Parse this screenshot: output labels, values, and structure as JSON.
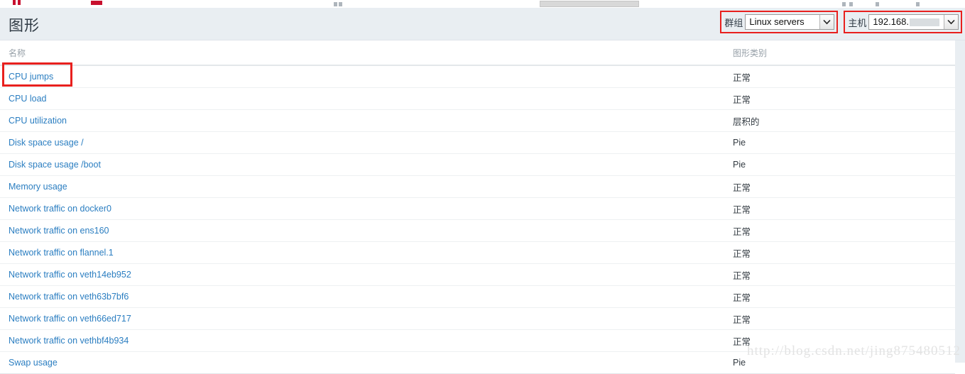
{
  "header": {
    "title": "图形",
    "group_filter": {
      "label": "群组",
      "value": "Linux servers"
    },
    "host_filter": {
      "label": "主机",
      "value": "192.168."
    }
  },
  "table": {
    "columns": [
      "名称",
      "图形类别"
    ],
    "rows": [
      {
        "name": "CPU jumps",
        "type": "正常"
      },
      {
        "name": "CPU load",
        "type": "正常"
      },
      {
        "name": "CPU utilization",
        "type": "层积的"
      },
      {
        "name": "Disk space usage /",
        "type": "Pie"
      },
      {
        "name": "Disk space usage /boot",
        "type": "Pie"
      },
      {
        "name": "Memory usage",
        "type": "正常"
      },
      {
        "name": "Network traffic on docker0",
        "type": "正常"
      },
      {
        "name": "Network traffic on ens160",
        "type": "正常"
      },
      {
        "name": "Network traffic on flannel.1",
        "type": "正常"
      },
      {
        "name": "Network traffic on veth14eb952",
        "type": "正常"
      },
      {
        "name": "Network traffic on veth63b7bf6",
        "type": "正常"
      },
      {
        "name": "Network traffic on veth66ed717",
        "type": "正常"
      },
      {
        "name": "Network traffic on vethbf4b934",
        "type": "正常"
      },
      {
        "name": "Swap usage",
        "type": "Pie"
      }
    ]
  },
  "watermark": "http://blog.csdn.net/jing875480512",
  "colors": {
    "link": "#2b7ec1",
    "highlight": "#e8201e",
    "header_bg": "#e9eef2"
  }
}
